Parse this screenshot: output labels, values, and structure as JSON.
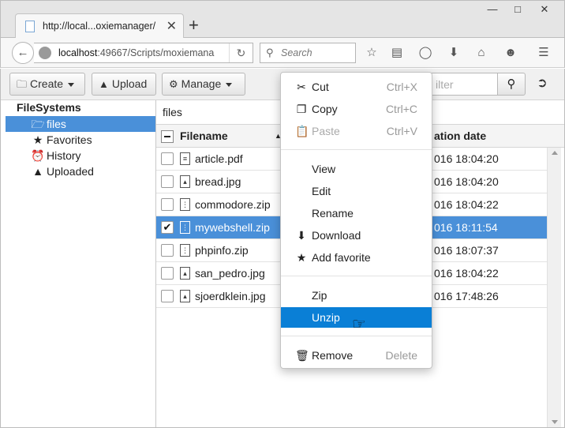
{
  "browser": {
    "tab_title": "http://local...oxiemanager/",
    "url_host": "localhost",
    "url_rest": ":49667/Scripts/moxiemana",
    "search_placeholder": "Search",
    "accent": "#4a90d9"
  },
  "toolbar": {
    "create_label": "Create",
    "upload_label": "Upload",
    "manage_label": "Manage",
    "filter_placeholder": "ilter"
  },
  "sidebar": {
    "root_label": "FileSystems",
    "items": [
      {
        "label": "files",
        "icon": "folder-icon",
        "selected": true
      },
      {
        "label": "Favorites",
        "icon": "star-icon",
        "selected": false
      },
      {
        "label": "History",
        "icon": "clock-icon",
        "selected": false
      },
      {
        "label": "Uploaded",
        "icon": "upload-icon",
        "selected": false
      }
    ]
  },
  "main": {
    "path": "files",
    "columns": {
      "filename": "Filename",
      "date": "ation date"
    },
    "rows": [
      {
        "name": "article.pdf",
        "date": "016 18:04:20",
        "checked": false,
        "selected": false,
        "icon": "pdf-icon"
      },
      {
        "name": "bread.jpg",
        "date": "016 18:04:20",
        "checked": false,
        "selected": false,
        "icon": "image-icon"
      },
      {
        "name": "commodore.zip",
        "date": "016 18:04:22",
        "checked": false,
        "selected": false,
        "icon": "zip-icon"
      },
      {
        "name": "mywebshell.zip",
        "date": "016 18:11:54",
        "checked": true,
        "selected": true,
        "icon": "zip-icon"
      },
      {
        "name": "phpinfo.zip",
        "date": "016 18:07:37",
        "checked": false,
        "selected": false,
        "icon": "zip-icon"
      },
      {
        "name": "san_pedro.jpg",
        "date": "016 18:04:22",
        "checked": false,
        "selected": false,
        "icon": "image-icon"
      },
      {
        "name": "sjoerdklein.jpg",
        "date": "016 17:48:26",
        "checked": false,
        "selected": false,
        "icon": "image-icon"
      }
    ]
  },
  "context_menu": {
    "cut": {
      "label": "Cut",
      "shortcut": "Ctrl+X"
    },
    "copy": {
      "label": "Copy",
      "shortcut": "Ctrl+C"
    },
    "paste": {
      "label": "Paste",
      "shortcut": "Ctrl+V"
    },
    "view": {
      "label": "View"
    },
    "edit": {
      "label": "Edit"
    },
    "rename": {
      "label": "Rename"
    },
    "download": {
      "label": "Download"
    },
    "add_favorite": {
      "label": "Add favorite"
    },
    "zip": {
      "label": "Zip"
    },
    "unzip": {
      "label": "Unzip"
    },
    "remove": {
      "label": "Remove",
      "shortcut": "Delete"
    }
  }
}
